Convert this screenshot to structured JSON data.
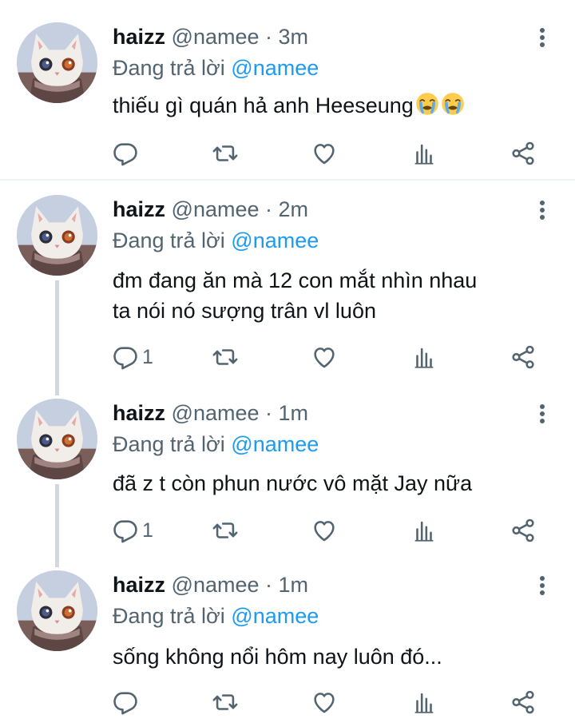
{
  "tweets": [
    {
      "name": "haizz",
      "handle": "@namee",
      "sep": "·",
      "time": "3m",
      "reply_prefix": "Đang trả lời",
      "reply_to": "@namee",
      "lines": [
        "thiếu gì quán hả anh Heeseung"
      ],
      "emoji": [
        "loudly-crying-face",
        "loudly-crying-face"
      ],
      "reply_count": ""
    },
    {
      "name": "haizz",
      "handle": "@namee",
      "sep": "·",
      "time": "2m",
      "reply_prefix": "Đang trả lời",
      "reply_to": "@namee",
      "lines": [
        "đm đang ăn mà 12 con mắt nhìn nhau",
        "ta nói nó sượng trân vl luôn"
      ],
      "reply_count": "1"
    },
    {
      "name": "haizz",
      "handle": "@namee",
      "sep": "·",
      "time": "1m",
      "reply_prefix": "Đang trả lời",
      "reply_to": "@namee",
      "lines": [
        "đã z t còn phun nước vô mặt Jay nữa"
      ],
      "reply_count": "1"
    },
    {
      "name": "haizz",
      "handle": "@namee",
      "sep": "·",
      "time": "1m",
      "reply_prefix": "Đang trả lời",
      "reply_to": "@namee",
      "lines": [
        "sống không nổi hôm nay luôn đó..."
      ],
      "reply_count": ""
    }
  ],
  "colors": {
    "accent": "#1d9bf0",
    "muted": "#536471",
    "text": "#0f1419",
    "line": "#cfd9de"
  }
}
